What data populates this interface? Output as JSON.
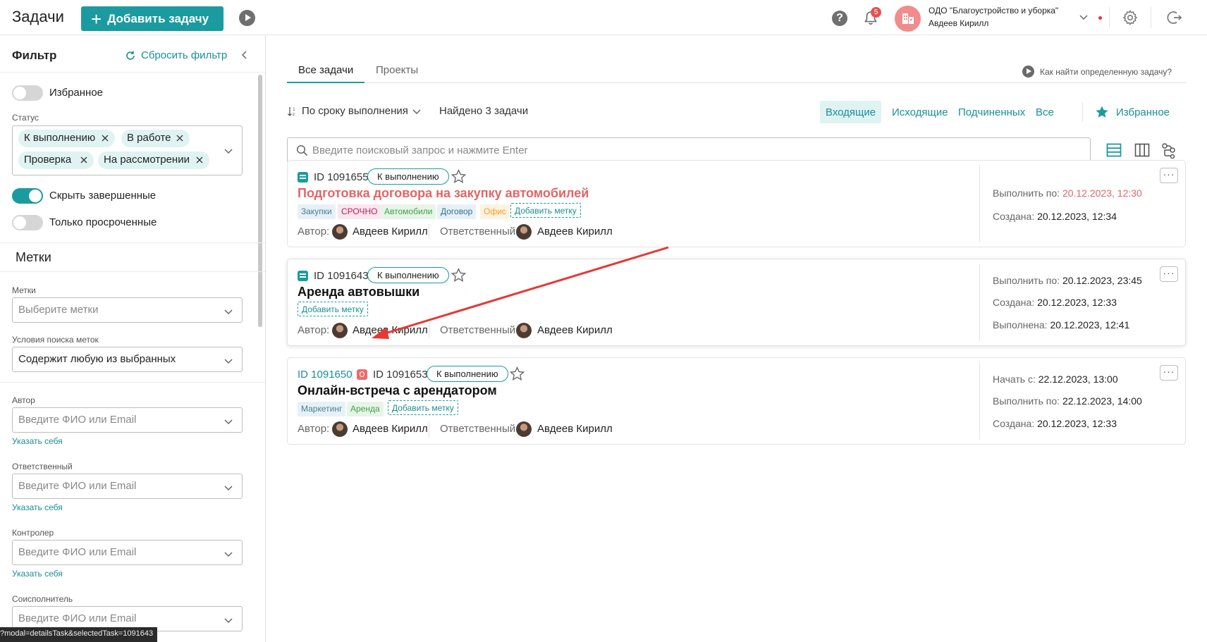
{
  "header": {
    "title": "Задачи",
    "add_button": "Добавить задачу",
    "notifications_count": "5",
    "org_name": "ОДО \"Благоустройство и уборка\"",
    "user_name": "Авдеев Кирилл"
  },
  "sidebar": {
    "title": "Фильтр",
    "reset_label": "Сбросить фильтр",
    "favorites_label": "Избранное",
    "status_label": "Статус",
    "status_chips": [
      "К выполнению",
      "В работе",
      "Проверка",
      "На рассмотрении"
    ],
    "hide_completed_label": "Скрыть завершенные",
    "only_overdue_label": "Только просроченные",
    "tags_section_title": "Метки",
    "tags_label": "Метки",
    "tags_placeholder": "Выберите метки",
    "tags_condition_label": "Условия поиска меток",
    "tags_condition_value": "Содержит любую из выбранных",
    "author_label": "Автор",
    "responsible_label": "Ответственный",
    "controller_label": "Контролер",
    "coexecutor_label": "Соисполнитель",
    "person_placeholder": "Введите ФИО или Email",
    "self_link": "Указать себя",
    "url_tooltip": "?modal=detailsTask&selectedTask=1091643"
  },
  "main": {
    "tabs": [
      "Все задачи",
      "Проекты"
    ],
    "help_link": "Как найти определенную задачу?",
    "sort_label": "По сроку выполнения",
    "found_label": "Найдено 3 задачи",
    "filter_tabs": [
      "Входящие",
      "Исходящие",
      "Подчиненных",
      "Все"
    ],
    "favorites_link": "Избранное",
    "search_placeholder": "Введите поисковый запрос и нажмите Enter",
    "author_label": "Автор:",
    "responsible_label": "Ответственный:",
    "add_tag_label": "Добавить метку",
    "tasks": [
      {
        "id": "ID 1091655",
        "status": "К выполнению",
        "title": "Подготовка договора на закупку автомобилей",
        "tags": [
          "Закупки",
          "СРОЧНО",
          "Автомобили",
          "Договор",
          "Офис"
        ],
        "author": "Авдеев Кирилл",
        "responsible": "Авдеев Кирилл",
        "due_label": "Выполнить по:",
        "due_value": "20.12.2023, 12:30",
        "created_label": "Создана:",
        "created_value": "20.12.2023, 12:34"
      },
      {
        "id": "ID 1091643",
        "status": "К выполнению",
        "title": "Аренда автовышки",
        "tags": [],
        "author": "Авдеев Кирилл",
        "responsible": "Авдеев Кирилл",
        "due_label": "Выполнить по:",
        "due_value": "20.12.2023, 23:45",
        "created_label": "Создана:",
        "created_value": "20.12.2023, 12:33",
        "done_label": "Выполнена:",
        "done_value": "20.12.2023, 12:41"
      },
      {
        "parent_id": "ID 1091650",
        "id": "ID 1091653",
        "status": "К выполнению",
        "title": "Онлайн-встреча с арендатором",
        "tags": [
          "Маркетинг",
          "Аренда"
        ],
        "author": "Авдеев Кирилл",
        "responsible": "Авдеев Кирилл",
        "start_label": "Начать с:",
        "start_value": "22.12.2023, 13:00",
        "due_label": "Выполнить по:",
        "due_value": "22.12.2023, 14:00",
        "created_label": "Создана:",
        "created_value": "20.12.2023, 12:33"
      }
    ]
  }
}
